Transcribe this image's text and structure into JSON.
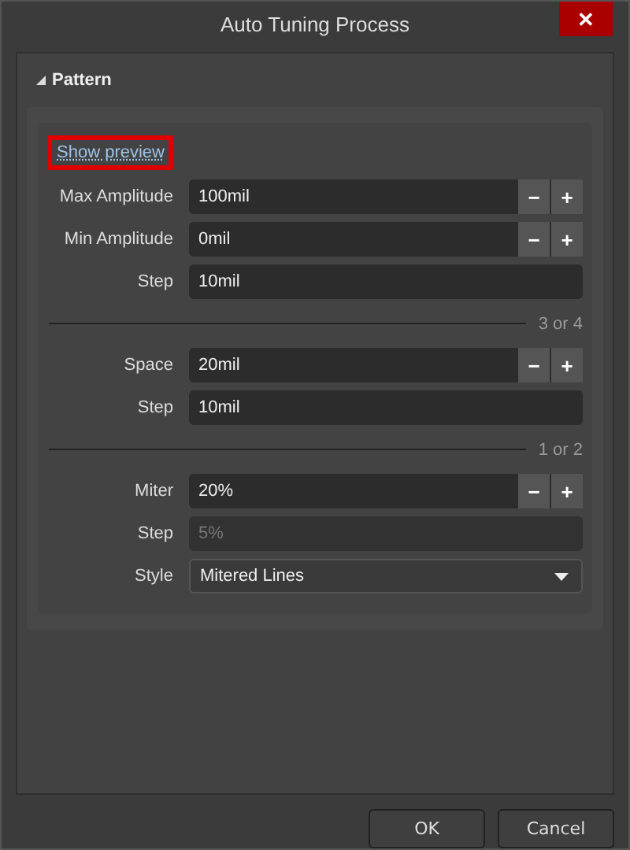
{
  "window": {
    "title": "Auto Tuning Process",
    "close": "✕"
  },
  "section": {
    "title": "Pattern",
    "expanded": true,
    "preview_link": {
      "label": "Show preview",
      "highlighted": true
    },
    "groups": [
      {
        "rows": [
          {
            "kind": "spin",
            "label": "Max Amplitude",
            "value": "100mil",
            "minus": "−",
            "plus": "+"
          },
          {
            "kind": "spin",
            "label": "Min Amplitude",
            "value": "0mil",
            "minus": "−",
            "plus": "+"
          },
          {
            "kind": "text",
            "label": "Step",
            "value": "10mil",
            "disabled": false
          }
        ]
      },
      {
        "caption": "3 or 4",
        "rows": [
          {
            "kind": "spin",
            "label": "Space",
            "value": "20mil",
            "minus": "−",
            "plus": "+"
          },
          {
            "kind": "text",
            "label": "Step",
            "value": "10mil",
            "disabled": false
          }
        ]
      },
      {
        "caption": "1 or 2",
        "rows": [
          {
            "kind": "spin",
            "label": "Miter",
            "value": "20%",
            "minus": "−",
            "plus": "+"
          },
          {
            "kind": "text",
            "label": "Step",
            "value": "5%",
            "disabled": true
          },
          {
            "kind": "select",
            "label": "Style",
            "value": "Mitered Lines"
          }
        ]
      }
    ]
  },
  "buttons": [
    "OK",
    "Cancel"
  ]
}
